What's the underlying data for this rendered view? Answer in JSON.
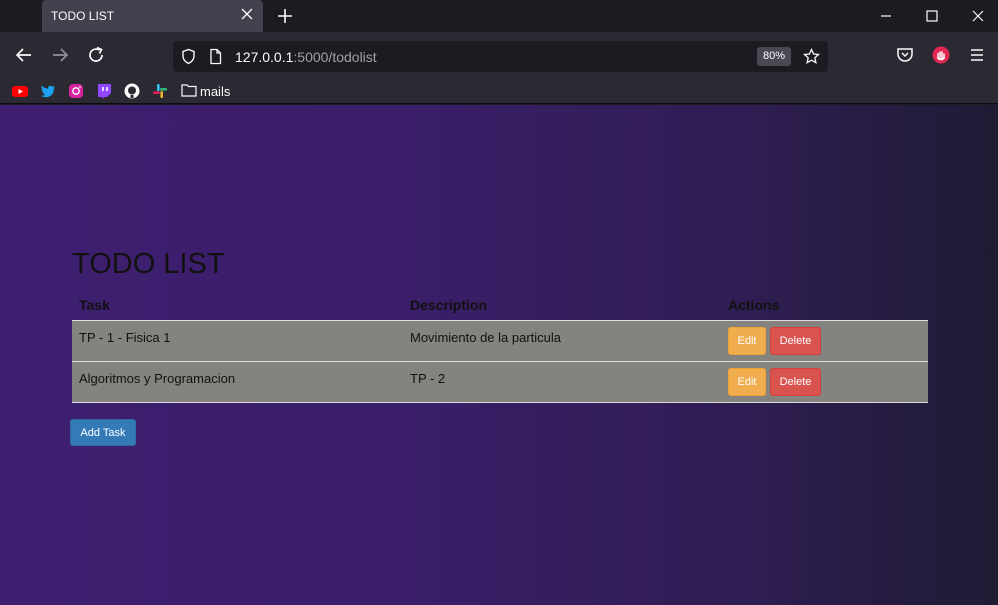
{
  "browser": {
    "tab": {
      "title": "TODO LIST"
    },
    "url": {
      "host": "127.0.0.1",
      "path": ":5000/todolist"
    },
    "zoom": "80%",
    "bookmarks": {
      "icons": [
        "youtube-icon",
        "twitter-icon",
        "instagram-icon",
        "twitch-icon",
        "github-icon",
        "slack-icon"
      ],
      "folder_label": "mails"
    },
    "colors": {
      "chrome_dark": "#1c1b22",
      "chrome_mid": "#2b2a33"
    }
  },
  "page": {
    "title": "TODO LIST",
    "table": {
      "headers": {
        "task": "Task",
        "description": "Description",
        "actions": "Actions"
      },
      "rows": [
        {
          "task": "TP - 1 - Fisica 1",
          "description": "Movimiento de la particula",
          "edit": "Edit",
          "delete": "Delete"
        },
        {
          "task": "Algoritmos y Programacion",
          "description": "TP - 2",
          "edit": "Edit",
          "delete": "Delete"
        }
      ]
    },
    "add_button": "Add Task",
    "colors": {
      "edit": "#f0ad4e",
      "delete": "#d9534f",
      "add": "#337ab7",
      "row_bg": "#858380"
    }
  }
}
